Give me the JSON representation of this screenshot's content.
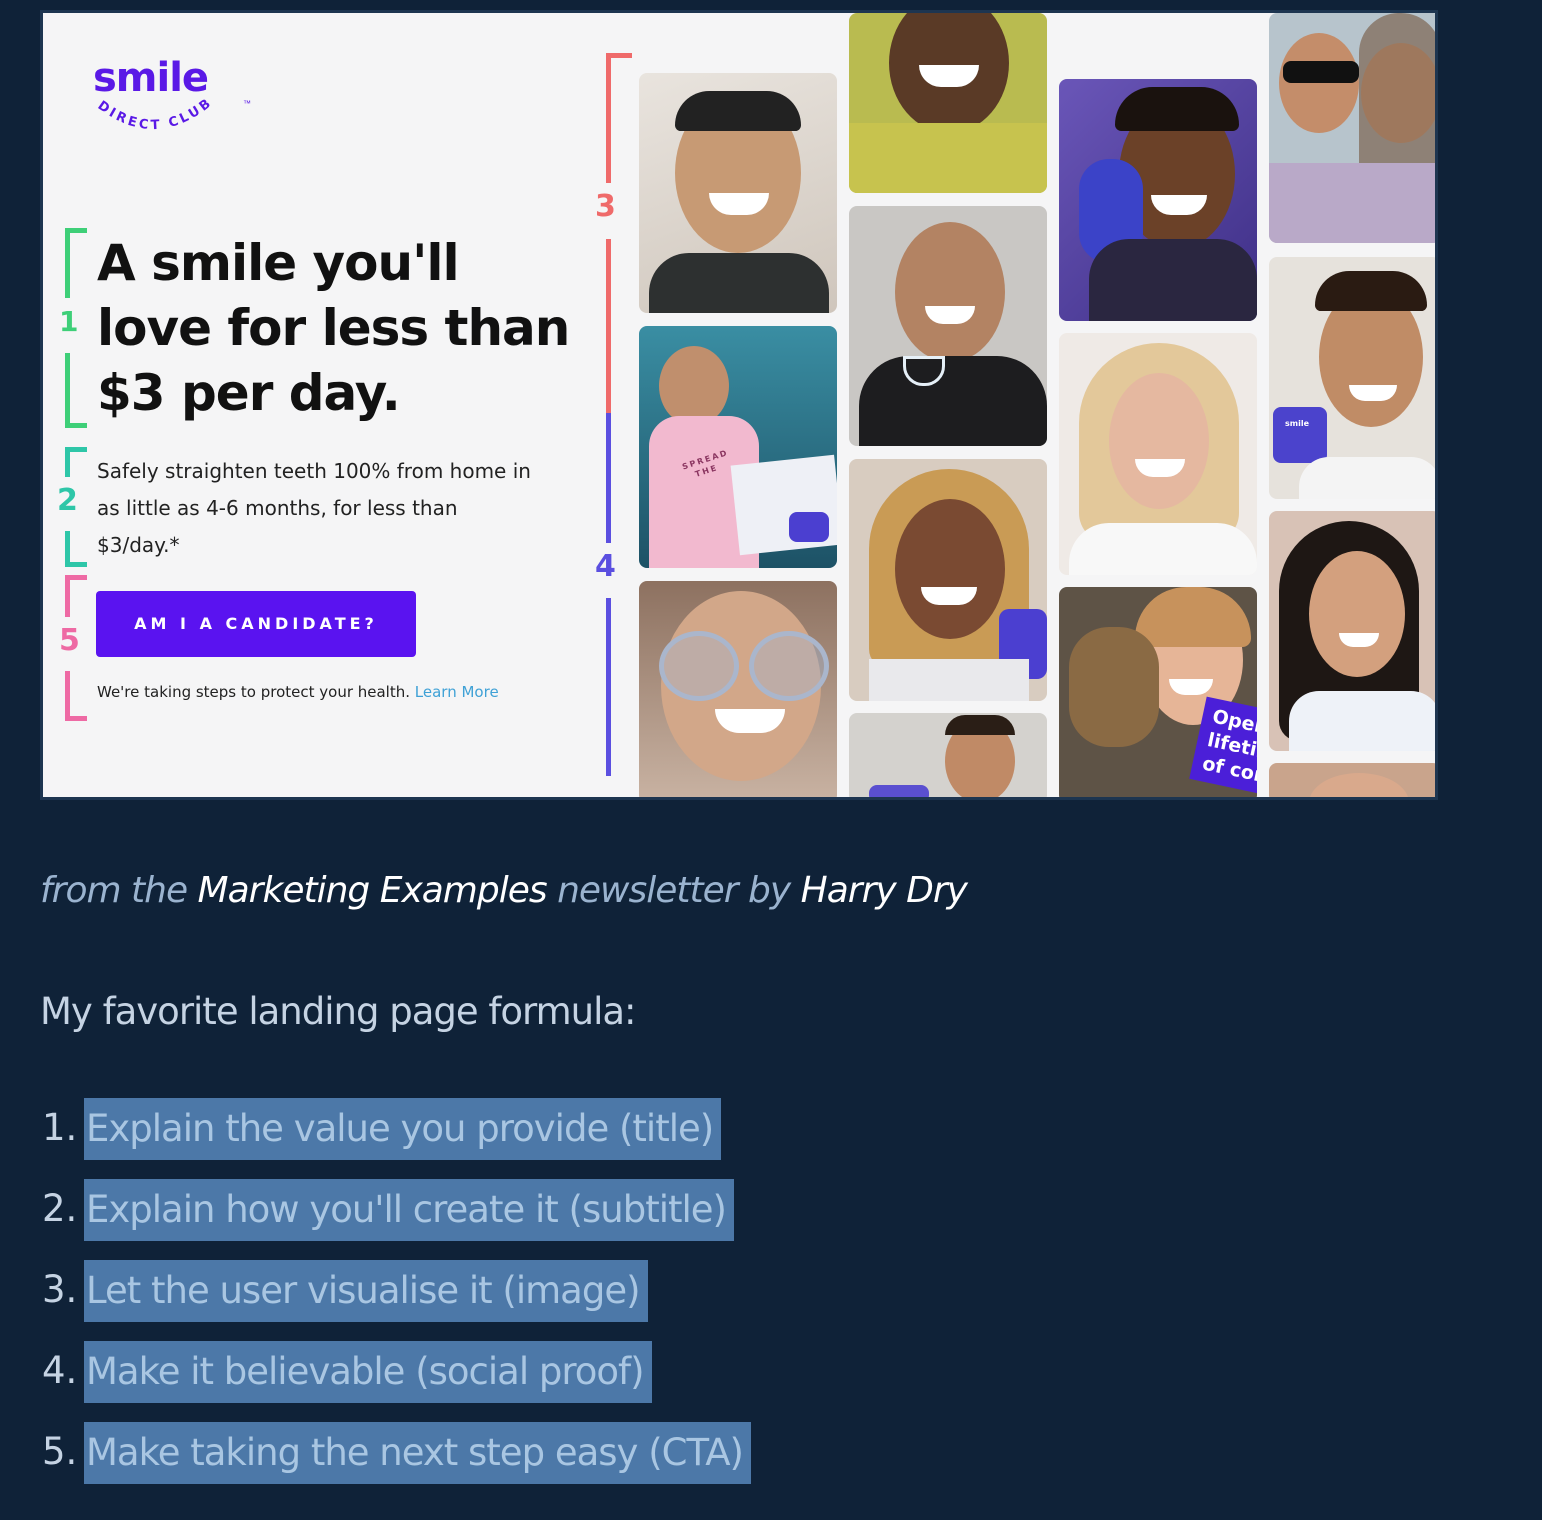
{
  "ad": {
    "logo_word": "smile",
    "logo_tm": "™",
    "logo_arc": "DIRECT CLUB",
    "headline_lines": [
      "A smile you'll",
      "love for less than",
      "$3 per day."
    ],
    "sub_lines": [
      "Safely straighten teeth 100% from home in",
      "as little as 4-6 months, for less than",
      "$3/day.*"
    ],
    "cta_label": "AM I A CANDIDATE?",
    "notice_text": "We're taking steps to protect your health.",
    "notice_link": "Learn More",
    "bracket_numbers": [
      "1",
      "2",
      "3",
      "4",
      "5"
    ],
    "badge_lines": [
      "Open",
      "lifetim",
      "of con"
    ],
    "case_text": "smile",
    "shirt_text": [
      "SPREAD",
      "THE"
    ],
    "colors": {
      "brand": "#5a13f0",
      "bracket_1": "#3ecf78",
      "bracket_2": "#2ec6a8",
      "bracket_3": "#ef6a6a",
      "bracket_4": "#5b4fe0",
      "bracket_5": "#ee6aa4"
    }
  },
  "credit": {
    "prefix": "from the",
    "newsletter": "Marketing Examples",
    "middle": "newsletter by",
    "author": "Harry Dry"
  },
  "intro": "My favorite landing page formula:",
  "formula": [
    {
      "num": "1.",
      "text": "Explain the value you provide (title)"
    },
    {
      "num": "2.",
      "text": "Explain how you'll create it (subtitle)"
    },
    {
      "num": "3.",
      "text": "Let the user visualise it (image)"
    },
    {
      "num": "4.",
      "text": "Make it believable (social proof)"
    },
    {
      "num": "5.",
      "text": "Make taking the next step easy (CTA)"
    }
  ]
}
